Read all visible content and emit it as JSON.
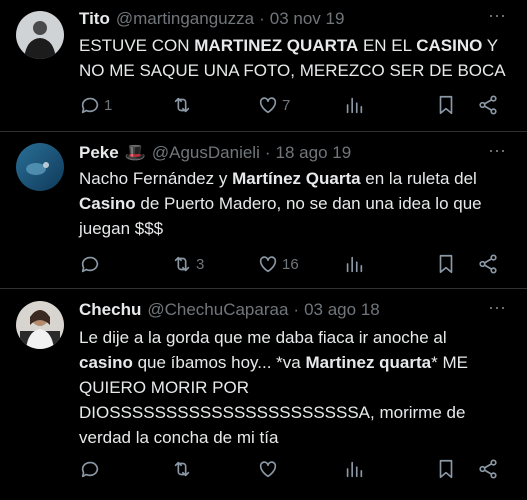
{
  "tweets": [
    {
      "name": "Tito",
      "badge": "",
      "handle": "@martinganguzza",
      "date": "03 nov 19",
      "text_segments": [
        {
          "t": "ESTUVE CON ",
          "b": false
        },
        {
          "t": "MARTINEZ QUARTA",
          "b": true
        },
        {
          "t": " EN EL ",
          "b": false
        },
        {
          "t": "CASINO",
          "b": true
        },
        {
          "t": " Y NO ME SAQUE UNA FOTO, MEREZCO SER DE BOCA",
          "b": false
        }
      ],
      "replies": "1",
      "retweets": "",
      "likes": "7"
    },
    {
      "name": "Peke",
      "badge": "🎩",
      "handle": "@AgusDanieli",
      "date": "18 ago 19",
      "text_segments": [
        {
          "t": "Nacho Fernández y ",
          "b": false
        },
        {
          "t": "Martínez Quarta",
          "b": true
        },
        {
          "t": " en la ruleta del ",
          "b": false
        },
        {
          "t": "Casino",
          "b": true
        },
        {
          "t": " de Puerto Madero, no se dan una idea lo que juegan $$$",
          "b": false
        }
      ],
      "replies": "",
      "retweets": "3",
      "likes": "16"
    },
    {
      "name": "Chechu",
      "badge": "",
      "handle": "@ChechuCaparaa",
      "date": "03 ago 18",
      "text_segments": [
        {
          "t": "Le dije a la gorda que me daba fiaca ir anoche al ",
          "b": false
        },
        {
          "t": "casino",
          "b": true
        },
        {
          "t": " que íbamos hoy... *va ",
          "b": false
        },
        {
          "t": "Martinez quarta",
          "b": true
        },
        {
          "t": "* ME QUIERO MORIR POR DIOSSSSSSSSSSSSSSSSSSSSSSA, morirme de verdad la concha de mi tía",
          "b": false
        }
      ],
      "replies": "",
      "retweets": "",
      "likes": ""
    }
  ],
  "separator": "·",
  "more_glyph": "⋯",
  "icons": [
    "reply-icon",
    "retweet-icon",
    "like-icon",
    "views-icon",
    "bookmark-icon",
    "share-icon"
  ]
}
